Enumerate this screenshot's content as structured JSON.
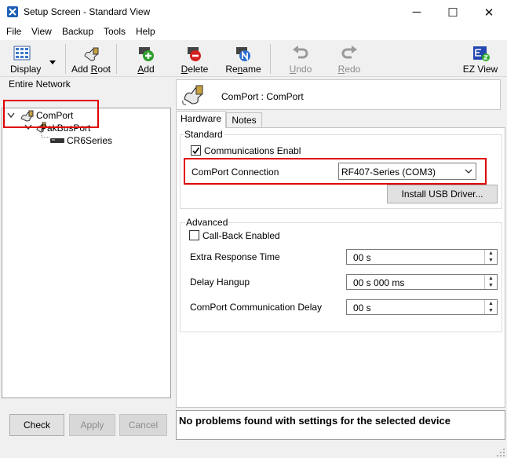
{
  "window": {
    "title": "Setup Screen - Standard View",
    "minimize_glyph": "─",
    "maximize_glyph": "☐",
    "close_glyph": "✕"
  },
  "menu": [
    "File",
    "View",
    "Backup",
    "Tools",
    "Help"
  ],
  "toolbar": {
    "display": "Display",
    "add_root_pre": "Add ",
    "add_root_u": "R",
    "add_root_post": "oot",
    "add_u": "A",
    "add_post": "dd",
    "delete_u": "D",
    "delete_post": "elete",
    "rename_pre": "Re",
    "rename_u": "n",
    "rename_post": "ame",
    "undo_u": "U",
    "undo_post": "ndo",
    "redo_u": "R",
    "redo_post": "edo",
    "ez_view": "EZ View"
  },
  "network": {
    "header": "Entire Network",
    "tree": [
      {
        "label": "ComPort",
        "level": 0
      },
      {
        "label": "PakBusPort",
        "level": 1
      },
      {
        "label": "CR6Series",
        "level": 2
      }
    ]
  },
  "bottom_buttons": {
    "check": "Check",
    "apply": "Apply",
    "cancel": "Cancel"
  },
  "device": {
    "title": "ComPort : ComPort"
  },
  "tabs": [
    "Hardware",
    "Notes"
  ],
  "standard": {
    "group_label": "Standard",
    "comm_enabled_label": "Communications Enabl",
    "comm_enabled_checked": true,
    "comport_connection_label": "ComPort Connection",
    "comport_connection_value": "RF407-Series (COM3)",
    "install_usb_driver": "Install USB Driver..."
  },
  "advanced": {
    "group_label": "Advanced",
    "callback_label": "Call-Back Enabled",
    "callback_checked": false,
    "extra_response_label": "Extra Response Time",
    "extra_response_value": "00 s",
    "delay_hangup_label": "Delay Hangup",
    "delay_hangup_value": "00 s 000 ms",
    "comport_delay_label": "ComPort Communication Delay",
    "comport_delay_value": "00 s"
  },
  "status": "No problems found with settings for the selected device",
  "colors": {
    "highlight_box": "#e00000",
    "app_icon": "#1e5fb4"
  }
}
